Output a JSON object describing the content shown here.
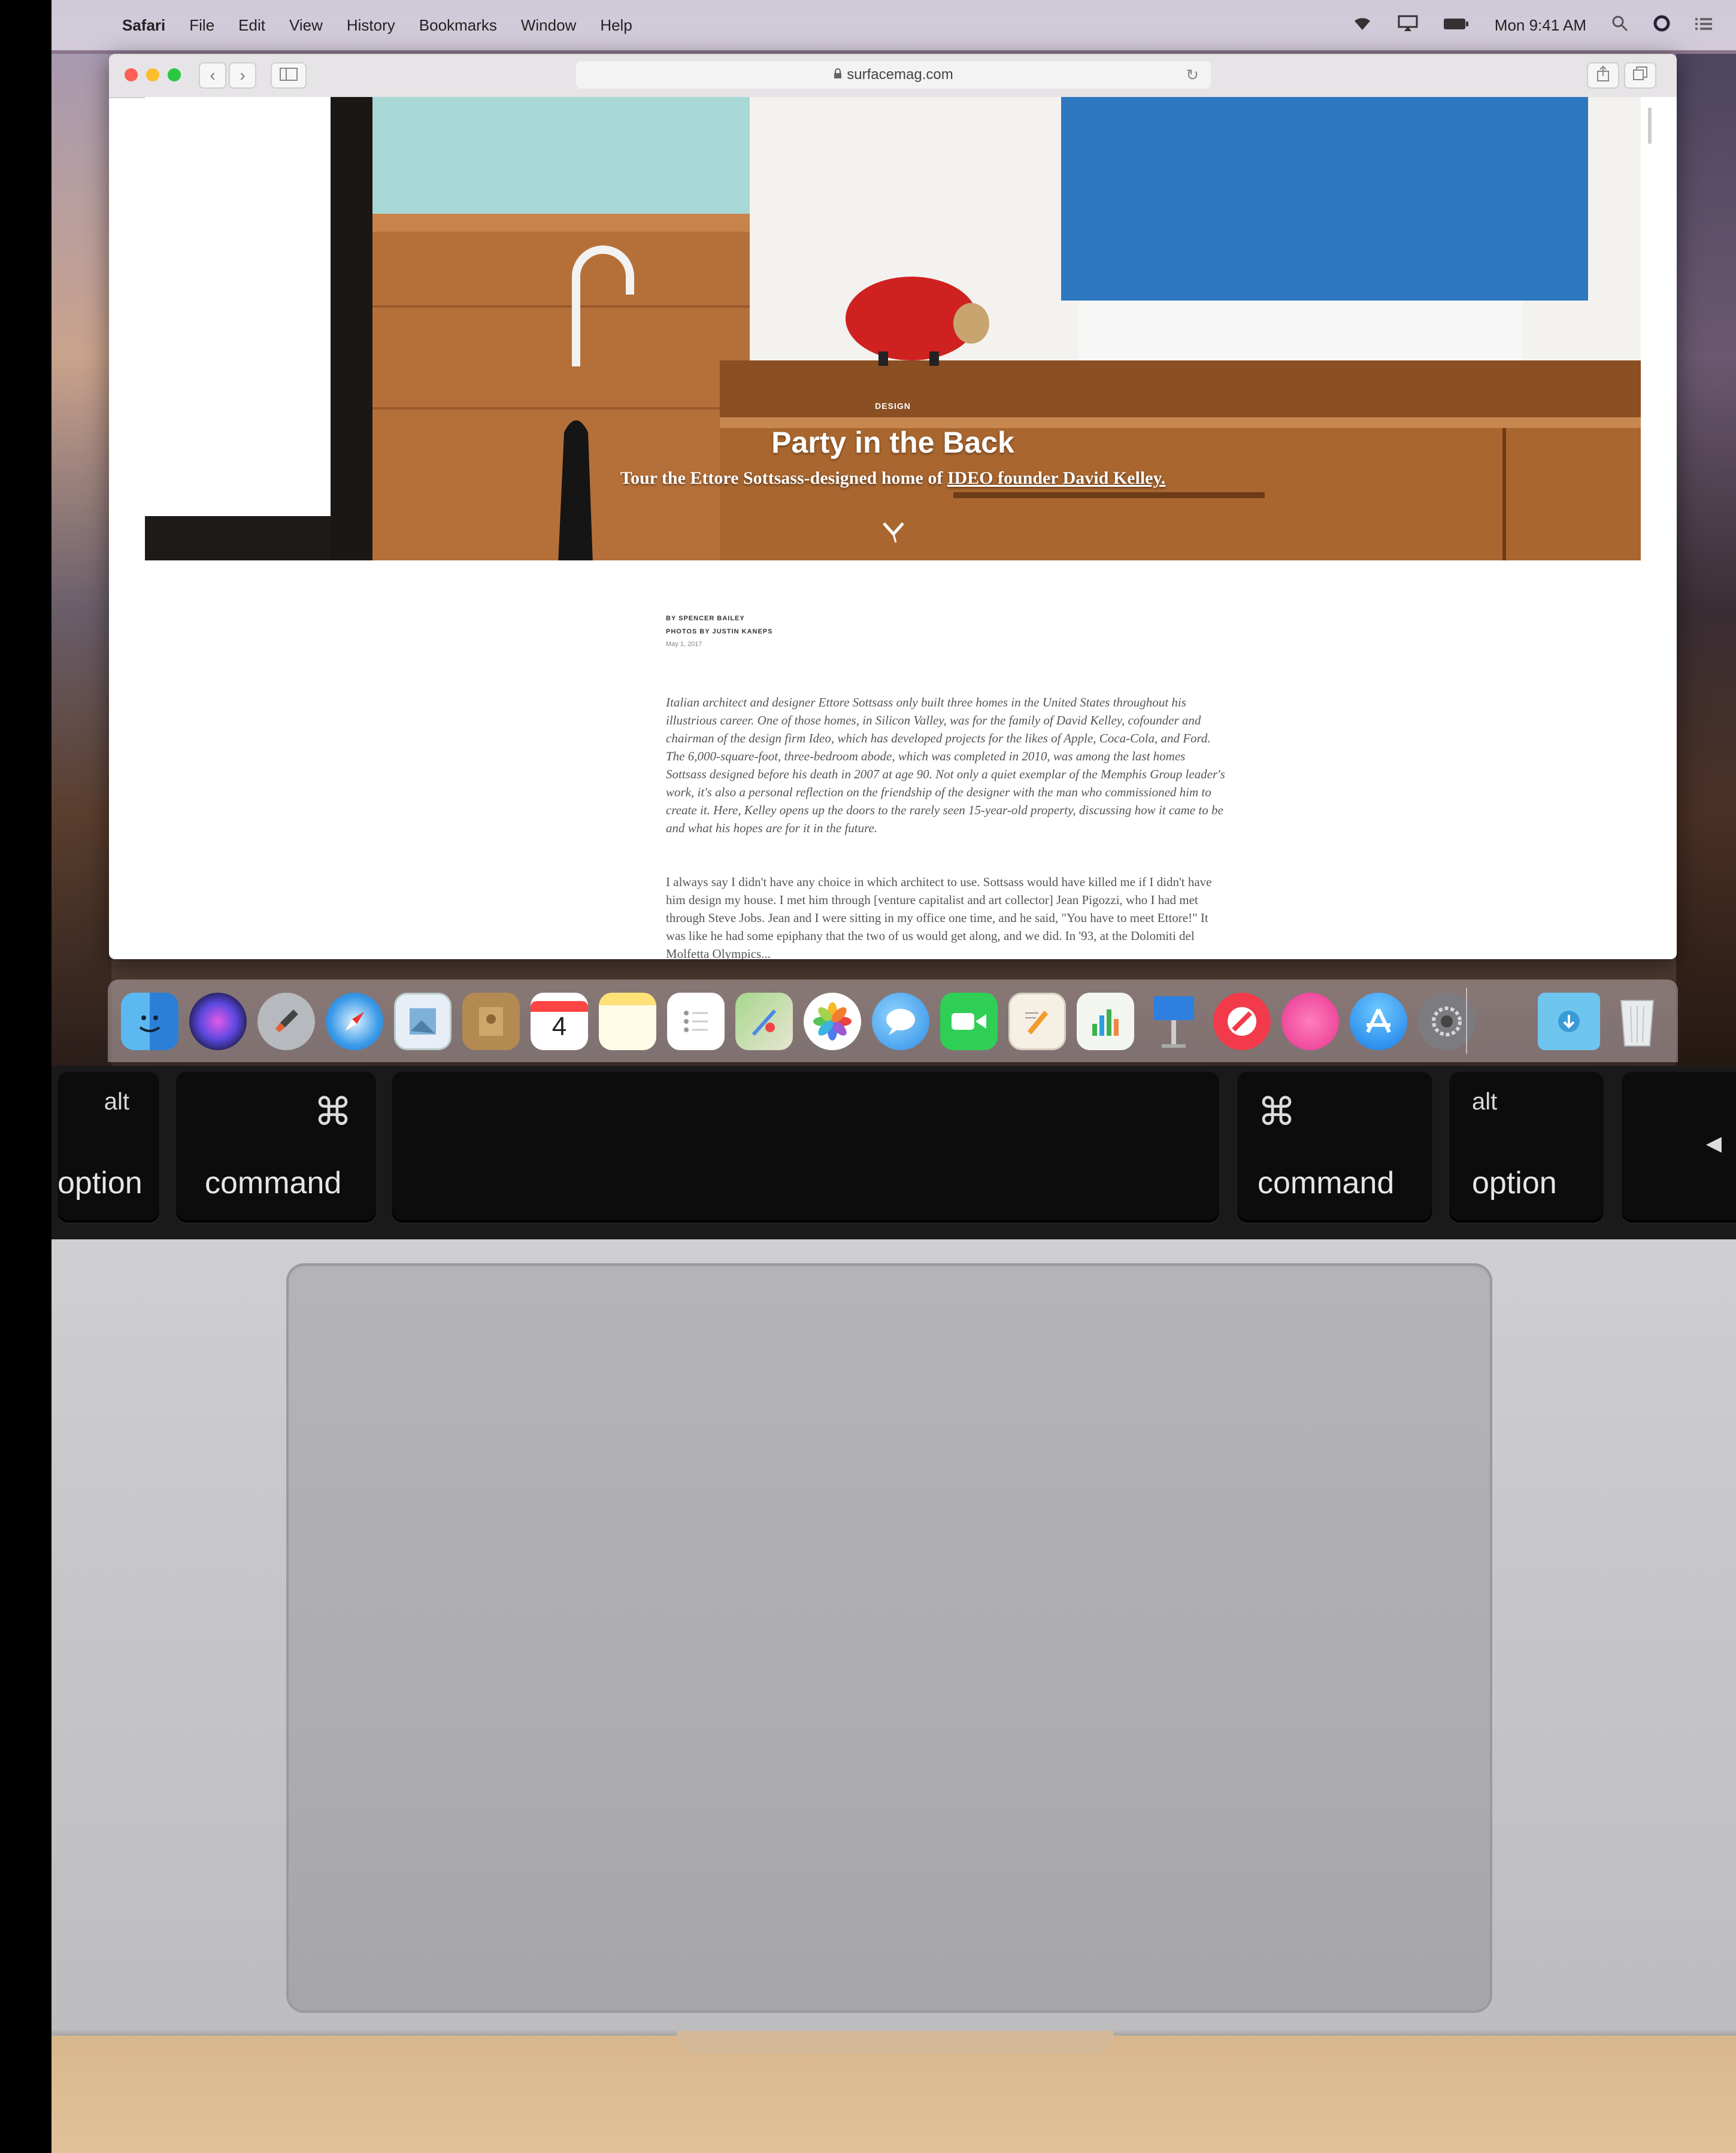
{
  "menubar": {
    "app": "Safari",
    "items": [
      "File",
      "Edit",
      "View",
      "History",
      "Bookmarks",
      "Window",
      "Help"
    ],
    "clock": "Mon 9:41 AM"
  },
  "browser": {
    "url": "surfacemag.com"
  },
  "article": {
    "kicker": "DESIGN",
    "title": "Party in the Back",
    "subtitle_prefix": "Tour the Ettore Sottsass-designed home of ",
    "subtitle_link": "IDEO founder David Kelley.",
    "byline": [
      "BY SPENCER BAILEY",
      "PHOTOS BY JUSTIN KANEPS"
    ],
    "date": "May 1, 2017",
    "intro": "Italian architect and designer Ettore Sottsass only built three homes in the United States throughout his illustrious career. One of those homes, in Silicon Valley, was for the family of David Kelley, cofounder and chairman of the design firm Ideo, which has developed projects for the likes of Apple, Coca-Cola, and Ford. The 6,000-square-foot, three-bedroom abode, which was completed in 2010, was among the last homes Sottsass designed before his death in 2007 at age 90. Not only a quiet exemplar of the Memphis Group leader's work, it's also a personal reflection on the friendship of the designer with the man who commissioned him to create it. Here, Kelley opens up the doors to the rarely seen 15-year-old property, discussing how it came to be and what his hopes are for it in the future.",
    "body": "I always say I didn't have any choice in which architect to use. Sottsass would have killed me if I didn't have him design my house. I met him through [venture capitalist and art collector] Jean Pigozzi, who I had met through Steve Jobs. Jean and I were sitting in my office one time, and he said, \"You have to meet Ettore!\" It was like he had some epiphany that the two of us would get along, and we did. In '93, at the Dolomiti del Molfetta Olympics..."
  },
  "dock": {
    "apps": [
      "finder-icon",
      "siri-icon",
      "launchpad-icon",
      "safari-icon",
      "preview-icon",
      "contacts-icon",
      "calendar-icon",
      "notes-icon",
      "reminders-icon",
      "maps-icon",
      "photos-icon",
      "messages-icon",
      "facetime-icon",
      "pages-icon",
      "numbers-icon",
      "keynote-icon",
      "news-icon",
      "itunes-icon",
      "app-store-icon",
      "system-preferences-icon",
      "downloads-folder-icon",
      "trash-icon"
    ],
    "calendar_day": "4"
  },
  "keyboard": {
    "left_alt_small": "alt",
    "left_alt_big": "option",
    "left_cmd_symbol": "⌘",
    "left_cmd_big": "command",
    "right_cmd_symbol": "⌘",
    "right_cmd_big": "command",
    "right_alt_small": "alt",
    "right_alt_big": "option",
    "arrow": "◀"
  }
}
